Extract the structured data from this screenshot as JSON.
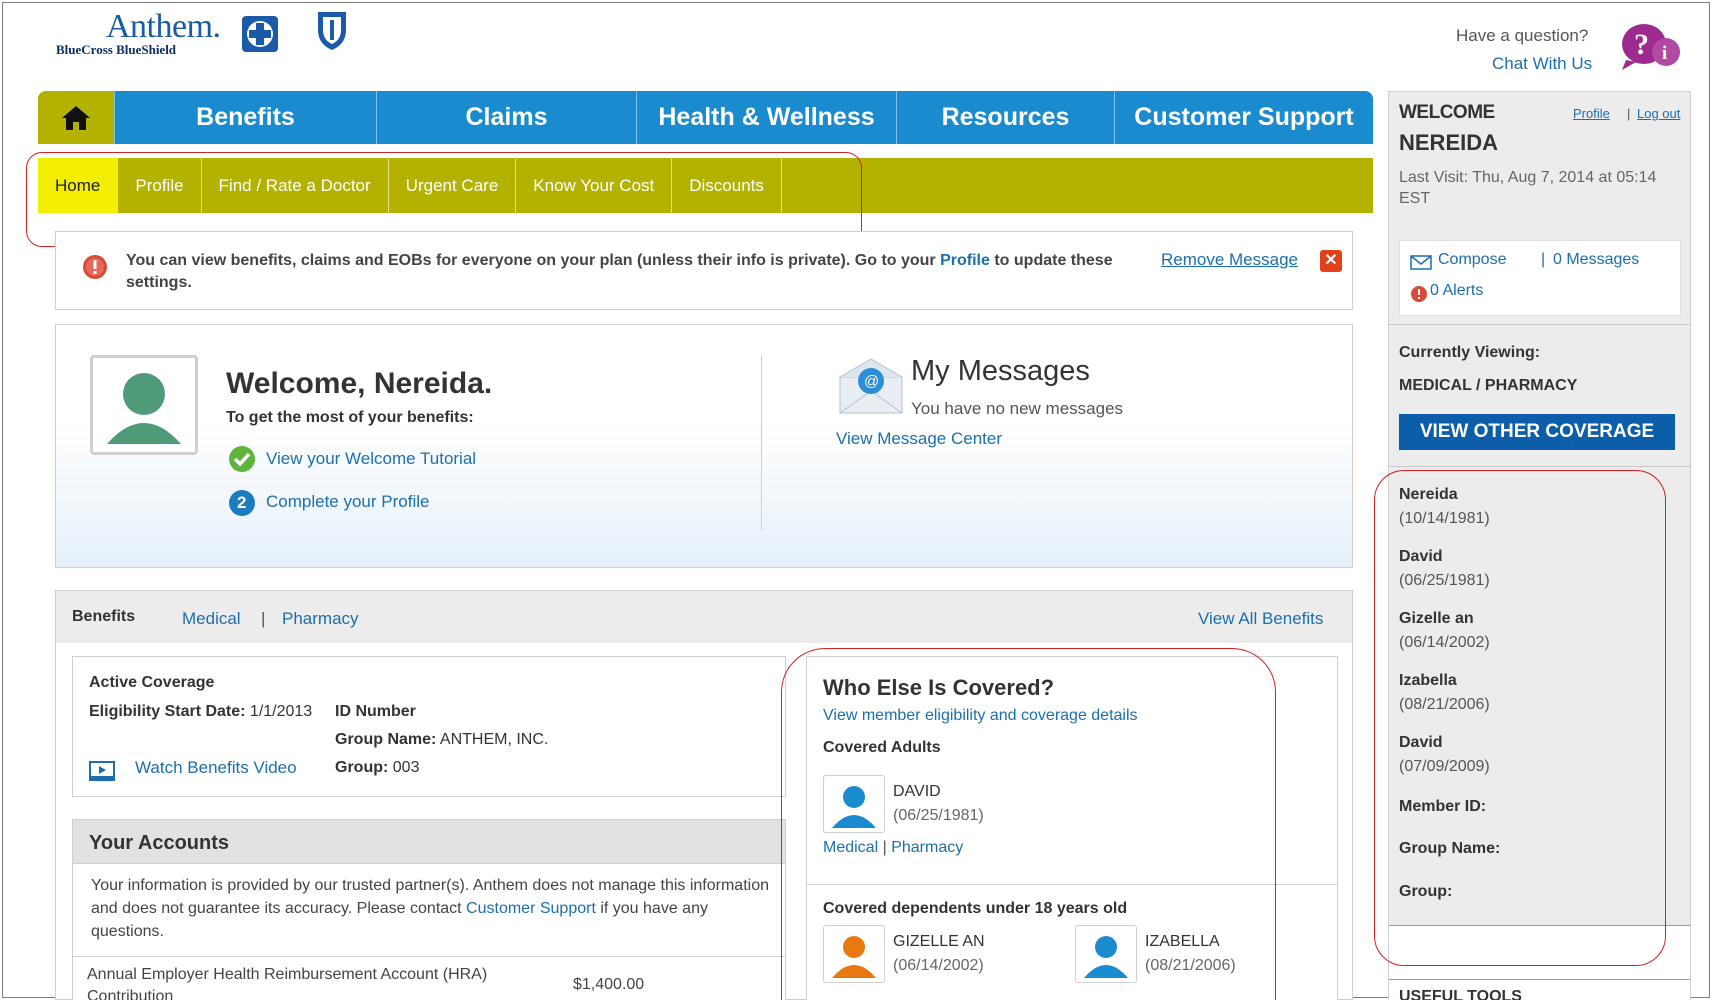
{
  "brand": {
    "name": "Anthem.",
    "subtitle": "BlueCross BlueShield"
  },
  "help": {
    "question": "Have a question?",
    "chat": "Chat With Us"
  },
  "nav": {
    "tabs": [
      {
        "label": "Benefits"
      },
      {
        "label": "Claims"
      },
      {
        "label": "Health & Wellness"
      },
      {
        "label": "Resources"
      },
      {
        "label": "Customer Support"
      }
    ]
  },
  "subnav": {
    "items": [
      {
        "label": "Home"
      },
      {
        "label": "Profile"
      },
      {
        "label": "Find / Rate a Doctor"
      },
      {
        "label": "Urgent Care"
      },
      {
        "label": "Know Your Cost"
      },
      {
        "label": "Discounts"
      }
    ]
  },
  "notice": {
    "text_before": "You can view benefits, claims and EOBs for everyone on your plan (unless their info is private). Go to your ",
    "link": "Profile",
    "text_after": " to update these settings.",
    "remove": "Remove Message"
  },
  "welcome": {
    "title": "Welcome, Nereida.",
    "subtitle": "To get the most of your benefits:",
    "link1": "View your Welcome Tutorial",
    "link2": "Complete your Profile",
    "step2": "2"
  },
  "messages": {
    "title": "My Messages",
    "sub": "You have no new messages",
    "link": "View Message Center"
  },
  "benefits": {
    "heading": "Benefits",
    "medical": "Medical",
    "sep": "|",
    "pharmacy": "Pharmacy",
    "view_all": "View All Benefits"
  },
  "active_coverage": {
    "title": "Active Coverage",
    "elig_label": "Eligibility Start Date:",
    "elig_value": "1/1/2013",
    "id_label": "ID Number",
    "group_name_label": "Group Name:",
    "group_name_value": "ANTHEM, INC.",
    "group_label": "Group:",
    "group_value": "003",
    "video": "Watch Benefits Video"
  },
  "accounts": {
    "title": "Your Accounts",
    "text_before": "Your information is provided by our trusted partner(s). Anthem does not manage this information and does not guarantee its accuracy. Please contact ",
    "link": "Customer Support",
    "text_after": " if you have any questions.",
    "row_label": "Annual Employer Health Reimbursement Account (HRA) Contribution",
    "row_value": "$1,400.00"
  },
  "covered": {
    "title": "Who Else Is Covered?",
    "link": "View member eligibility and coverage details",
    "adults_label": "Covered Adults",
    "adults": [
      {
        "name": "DAVID",
        "dob": "(06/25/1981)"
      }
    ],
    "adult_links": {
      "medical": "Medical",
      "sep": "|",
      "pharmacy": "Pharmacy"
    },
    "deps_label": "Covered dependents under 18 years old",
    "dependents": [
      {
        "name": "GIZELLE AN",
        "dob": "(06/14/2002)",
        "color": "#e8780f"
      },
      {
        "name": "IZABELLA",
        "dob": "(08/21/2006)",
        "color": "#1b8bd0"
      }
    ]
  },
  "sidebar": {
    "welcome": "WELCOME",
    "name": "NEREIDA",
    "profile": "Profile",
    "pipe": "|",
    "logout": "Log out",
    "last_visit": "Last Visit: Thu, Aug 7, 2014 at 05:14 EST",
    "compose": "Compose",
    "pipe2": "|",
    "messages": "0 Messages",
    "alerts": "0 Alerts",
    "viewing_label": "Currently Viewing:",
    "coverage": "MEDICAL / PHARMACY",
    "view_other": "VIEW OTHER COVERAGE",
    "members": [
      {
        "name": "Nereida",
        "dob": "(10/14/1981)"
      },
      {
        "name": "David",
        "dob": "(06/25/1981)"
      },
      {
        "name": "Gizelle an",
        "dob": "(06/14/2002)"
      },
      {
        "name": "Izabella",
        "dob": "(08/21/2006)"
      },
      {
        "name": "David",
        "dob": "(07/09/2009)"
      }
    ],
    "member_id_label": "Member ID:",
    "group_name_label": "Group Name:",
    "group_label": "Group:",
    "useful_tools": "USEFUL TOOLS"
  },
  "colors": {
    "nav_blue": "#1b8bd0",
    "nav_olive": "#b4b200",
    "active_yellow": "#f4ee00",
    "link_blue": "#1c6fae",
    "button_blue": "#0c5ea8",
    "annotation_red": "#d62020"
  },
  "icons": {
    "home": "home-icon",
    "help": "help-chat-icon",
    "alert": "alert-icon",
    "check": "check-icon",
    "mail": "mail-icon",
    "video": "video-icon",
    "avatar": "avatar-icon"
  }
}
